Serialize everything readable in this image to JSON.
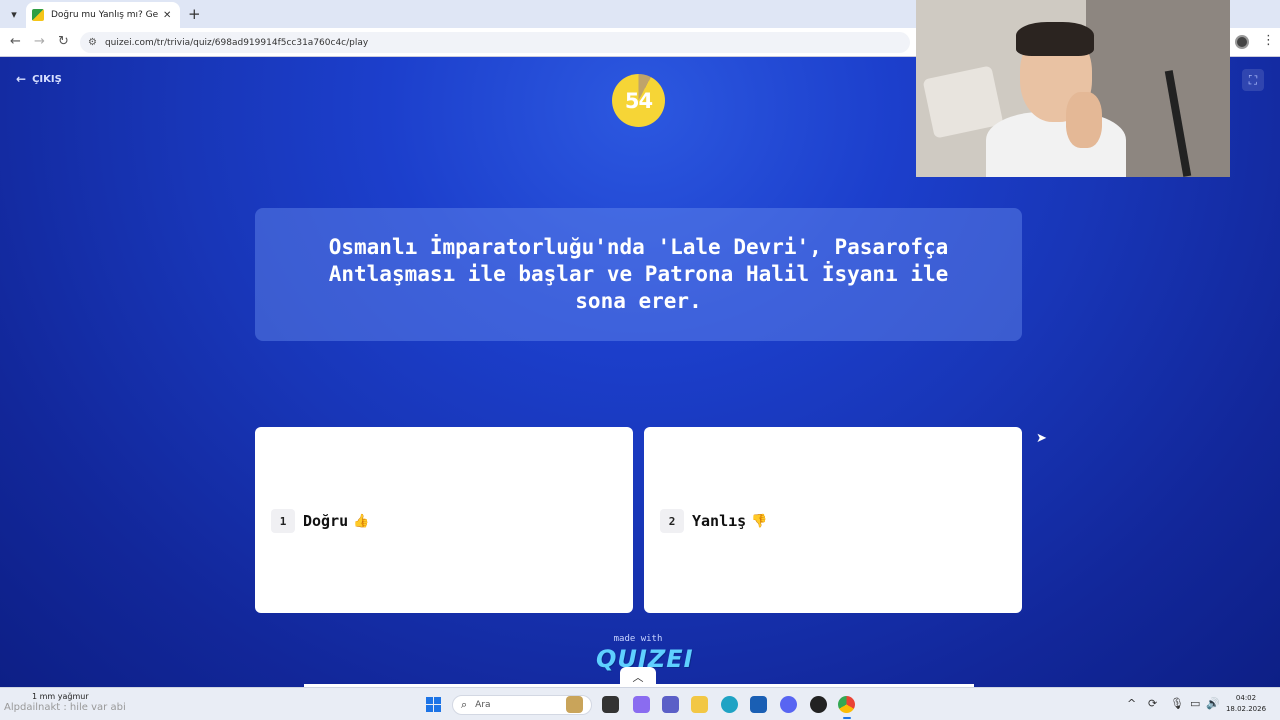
{
  "browser": {
    "tab_title": "Doğru mu Yanlış mı? Genel Kül",
    "tab_close": "✕",
    "new_tab": "+",
    "url": "quizei.com/tr/trivia/quiz/698ad919914f5cc31a760c4c/play",
    "icons": [
      "back-arrow-icon",
      "forward-arrow-icon",
      "reload-icon",
      "site-settings-icon",
      "profile-icon",
      "menu-kebab-icon"
    ]
  },
  "quiz": {
    "exit_label": "ÇIKIŞ",
    "timer_value": "54",
    "timer_remaining_fraction": 0.92,
    "question": "Osmanlı İmparatorluğu'nda 'Lale Devri', Pasarofça Antlaşması ile başlar ve Patrona Halil İsyanı ile sona erer.",
    "answers": [
      {
        "key": "1",
        "label": "Doğru",
        "icon": "thumbs-up-icon",
        "glyph": "👍"
      },
      {
        "key": "2",
        "label": "Yanlış",
        "icon": "thumbs-down-icon",
        "glyph": "👎"
      }
    ],
    "footer_made_with": "made with",
    "footer_brand": "QUIZEI"
  },
  "colors": {
    "page_accent": "#1c3fcc",
    "timer_yellow": "#f6d536",
    "card_white": "#ffffff"
  },
  "taskbar": {
    "weather_temp": "1 mm yağmur",
    "weather_desc": "Alpdailnakt : hile var abi",
    "search_placeholder": "Ara",
    "clock_time": "04:02",
    "clock_date": "18.02.2026"
  }
}
